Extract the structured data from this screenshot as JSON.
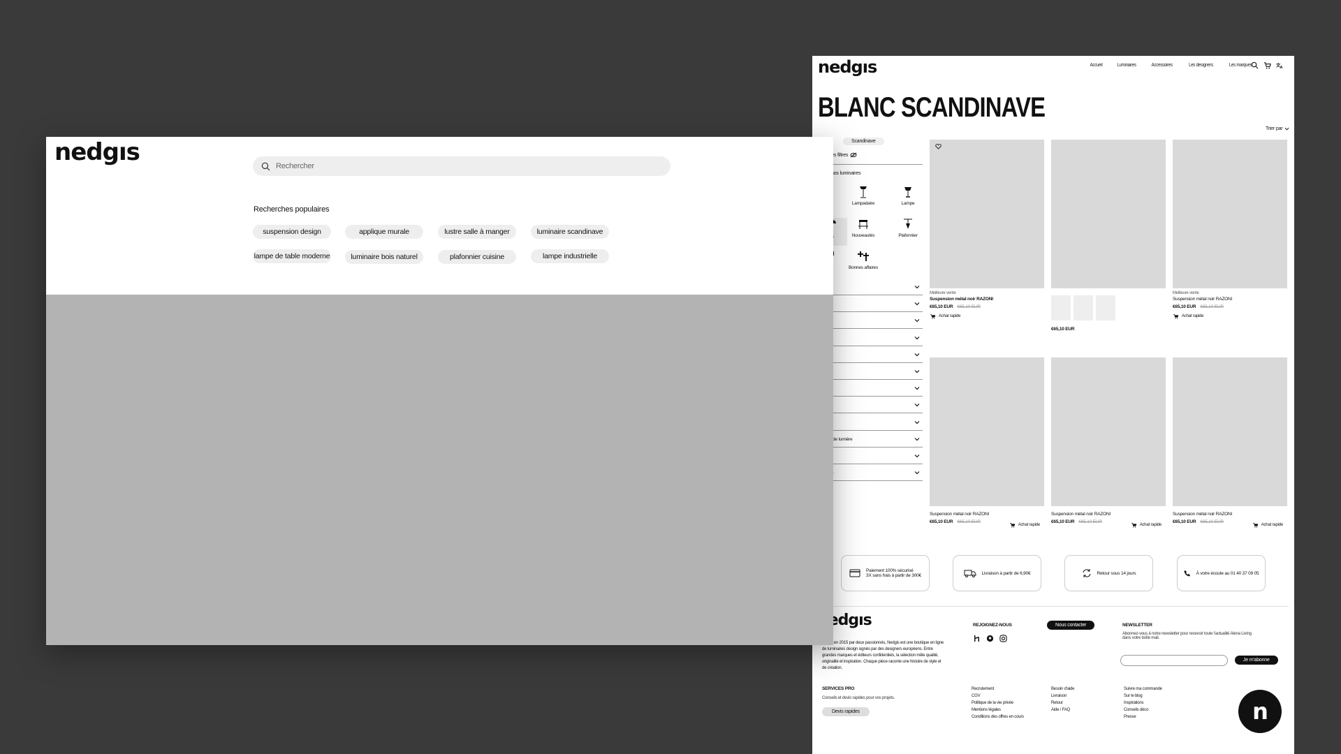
{
  "right_page": {
    "logo": "nedgıs",
    "nav": [
      "Accueil",
      "Luminaires",
      "Accessoires",
      "Les designers",
      "Les marques"
    ],
    "header_icons": [
      "search-icon",
      "cart-icon",
      "translate-icon"
    ],
    "title": "BLANC SCANDINAVE",
    "sort_label": "Trier par",
    "active_chip": "Scandinave",
    "filters_toggle": "r les filtres",
    "categories_title": "z nos luminaires",
    "categories": [
      {
        "label": "s",
        "icon": "lamp-icon"
      },
      {
        "label": "Lampadaire",
        "icon": "floor-lamp-icon"
      },
      {
        "label": "Lampe",
        "icon": "table-lamp-icon"
      },
      {
        "label": "sion",
        "icon": "pendant-icon"
      },
      {
        "label": "Nouveautés",
        "icon": "new-icon"
      },
      {
        "label": "Plafonnier",
        "icon": "ceiling-lamp-icon"
      },
      {
        "label": "ue",
        "icon": "wall-lamp-icon"
      },
      {
        "label": "Bonnes affaires",
        "icon": "deals-icon"
      }
    ],
    "filters": [
      "",
      "",
      "",
      "",
      "",
      "",
      "",
      "",
      "",
      "e de lumière",
      "e",
      "ce"
    ],
    "products": [
      {
        "tag": "Meilleure vente",
        "name": "Suspension métal noir RAZONI",
        "price": "€65,10 EUR",
        "old_price": "€65,10 EUR",
        "quick_buy": "Achat rapide"
      },
      {
        "tag": "",
        "name": "",
        "price": "€65,10 EUR",
        "old_price": "",
        "quick_buy": ""
      },
      {
        "tag": "Meilleure vente",
        "name": "Suspension métal noir RAZONI",
        "price": "€65,10 EUR",
        "old_price": "€65,10 EUR",
        "quick_buy": "Achat rapide"
      },
      {
        "tag": "",
        "name": "Suspension métal noir RAZONI",
        "price": "€65,10 EUR",
        "old_price": "€65,10 EUR",
        "quick_buy": "Achat rapide"
      },
      {
        "tag": "",
        "name": "Suspension métal noir RAZONI",
        "price": "€65,10 EUR",
        "old_price": "€65,10 EUR",
        "quick_buy": "Achat rapide"
      },
      {
        "tag": "",
        "name": "Suspension métal noir RAZONI",
        "price": "€65,10 EUR",
        "old_price": "€65,10 EUR",
        "quick_buy": "Achat rapide"
      }
    ],
    "features": [
      {
        "l1": "Paiement 100% sécurisé",
        "l2": "3X sans frais à partir de 300€",
        "icon": "card-icon"
      },
      {
        "l1": "Livraison à partir de 6,90€",
        "l2": "",
        "icon": "truck-icon"
      },
      {
        "l1": "Retour sous 14 jours",
        "l2": "",
        "icon": "return-icon"
      },
      {
        "l1": "À votre écoute au 01 40 37 09 05",
        "l2": "",
        "icon": "phone-icon"
      }
    ],
    "footer": {
      "logo": "nedgıs",
      "about": "Créée en 2015 par deux passionnés, Nedgis est une boutique en ligne de luminaires design signés par des designers européens. Entre grandes marques et éditeurs confidentiels, la sélection mêle qualité, originalité et inspiration. Chaque pièce raconte une histoire de style et de création.",
      "join_title": "REJOIGNEZ-NOUS",
      "contact_button": "Nous contacter",
      "newsletter_title": "NEWSLETTER",
      "newsletter_text": "Abonnez-vous à notre newsletter pour recevoir toute l'actualité Alena Living dans votre boîte mail.",
      "subscribe_button": "Je m'abonne",
      "pro_title": "SERVICES PRO",
      "pro_text": "Conseils et devis rapides pour vos projets.",
      "devis_button": "Devis rapides",
      "col1": [
        "Recrutement",
        "CGV",
        "Politique de la vie privée",
        "Mentions légales",
        "Conditions des offres en cours"
      ],
      "col2": [
        "Besoin d'aide",
        "Livraison",
        "Retour",
        "Aide / FAQ"
      ],
      "col3": [
        "Suivre ma commande",
        "Sur le blog",
        "Inspirations",
        "Conseils déco",
        "Presse"
      ],
      "badge_letter": "n"
    }
  },
  "search_overlay": {
    "logo": "nedgıs",
    "search_placeholder": "Rechercher",
    "popular_title": "Recherches populaires",
    "popular": [
      "suspension design",
      "applique murale",
      "lustre salle à manger",
      "luminaire scandinave",
      "lampe de table moderne",
      "luminaire bois naturel",
      "plafonnier cuisine",
      "lampe industrielle"
    ]
  },
  "colors": {
    "background": "#3a3a3a",
    "placeholder": "#d9d9d9",
    "overlay_dim": "#b3b3b3"
  }
}
